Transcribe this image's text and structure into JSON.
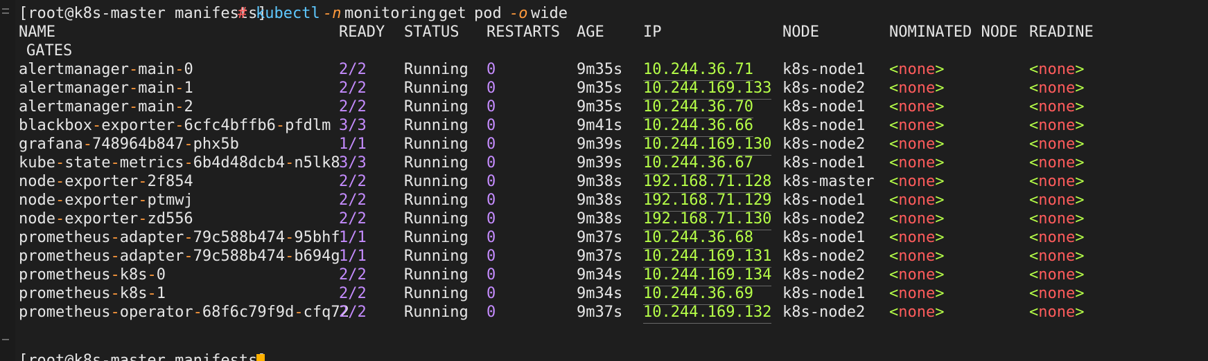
{
  "prompt": {
    "user_host_dir": "[root@k8s-master manifests]",
    "symbol": "#",
    "command": "kubectl",
    "flag_namespace": "-n",
    "namespace": "monitoring",
    "verb": "get",
    "resource": "pod",
    "flag_output": "-o",
    "output": "wide"
  },
  "headers": {
    "name": "NAME",
    "ready": "READY",
    "status": "STATUS",
    "restarts": "RESTARTS",
    "age": "AGE",
    "ip": "IP",
    "node": "NODE",
    "nominated_node": "NOMINATED NODE",
    "readiness_gates_part1": "READINE",
    "readiness_gates_part2": "GATES"
  },
  "pods": [
    {
      "name_parts": [
        "alertmanager",
        "main",
        "0"
      ],
      "ready_cur": "2",
      "ready_total": "2",
      "status": "Running",
      "restarts": "0",
      "age": "9m35s",
      "ip": "10.244.36.71",
      "node": "k8s-node1"
    },
    {
      "name_parts": [
        "alertmanager",
        "main",
        "1"
      ],
      "ready_cur": "2",
      "ready_total": "2",
      "status": "Running",
      "restarts": "0",
      "age": "9m35s",
      "ip": "10.244.169.133",
      "node": "k8s-node2"
    },
    {
      "name_parts": [
        "alertmanager",
        "main",
        "2"
      ],
      "ready_cur": "2",
      "ready_total": "2",
      "status": "Running",
      "restarts": "0",
      "age": "9m35s",
      "ip": "10.244.36.70",
      "node": "k8s-node1"
    },
    {
      "name_parts": [
        "blackbox",
        "exporter",
        "6cfc4bffb6",
        "pfdlm"
      ],
      "ready_cur": "3",
      "ready_total": "3",
      "status": "Running",
      "restarts": "0",
      "age": "9m41s",
      "ip": "10.244.36.66",
      "node": "k8s-node1"
    },
    {
      "name_parts": [
        "grafana",
        "748964b847",
        "phx5b"
      ],
      "ready_cur": "1",
      "ready_total": "1",
      "status": "Running",
      "restarts": "0",
      "age": "9m39s",
      "ip": "10.244.169.130",
      "node": "k8s-node2"
    },
    {
      "name_parts": [
        "kube",
        "state",
        "metrics",
        "6b4d48dcb4",
        "n5lk8"
      ],
      "ready_cur": "3",
      "ready_total": "3",
      "status": "Running",
      "restarts": "0",
      "age": "9m39s",
      "ip": "10.244.36.67",
      "node": "k8s-node1"
    },
    {
      "name_parts": [
        "node",
        "exporter",
        "2f854"
      ],
      "ready_cur": "2",
      "ready_total": "2",
      "status": "Running",
      "restarts": "0",
      "age": "9m38s",
      "ip": "192.168.71.128",
      "node": "k8s-master"
    },
    {
      "name_parts": [
        "node",
        "exporter",
        "ptmwj"
      ],
      "ready_cur": "2",
      "ready_total": "2",
      "status": "Running",
      "restarts": "0",
      "age": "9m38s",
      "ip": "192.168.71.129",
      "node": "k8s-node1"
    },
    {
      "name_parts": [
        "node",
        "exporter",
        "zd556"
      ],
      "ready_cur": "2",
      "ready_total": "2",
      "status": "Running",
      "restarts": "0",
      "age": "9m38s",
      "ip": "192.168.71.130",
      "node": "k8s-node2"
    },
    {
      "name_parts": [
        "prometheus",
        "adapter",
        "79c588b474",
        "95bhf"
      ],
      "ready_cur": "1",
      "ready_total": "1",
      "status": "Running",
      "restarts": "0",
      "age": "9m37s",
      "ip": "10.244.36.68",
      "node": "k8s-node1"
    },
    {
      "name_parts": [
        "prometheus",
        "adapter",
        "79c588b474",
        "b694g"
      ],
      "ready_cur": "1",
      "ready_total": "1",
      "status": "Running",
      "restarts": "0",
      "age": "9m37s",
      "ip": "10.244.169.131",
      "node": "k8s-node2"
    },
    {
      "name_parts": [
        "prometheus",
        "k8s",
        "0"
      ],
      "ready_cur": "2",
      "ready_total": "2",
      "status": "Running",
      "restarts": "0",
      "age": "9m34s",
      "ip": "10.244.169.134",
      "node": "k8s-node2"
    },
    {
      "name_parts": [
        "prometheus",
        "k8s",
        "1"
      ],
      "ready_cur": "2",
      "ready_total": "2",
      "status": "Running",
      "restarts": "0",
      "age": "9m34s",
      "ip": "10.244.36.69",
      "node": "k8s-node1"
    },
    {
      "name_parts": [
        "prometheus",
        "operator",
        "68f6c79f9d",
        "cfq72"
      ],
      "ready_cur": "2",
      "ready_total": "2",
      "status": "Running",
      "restarts": "0",
      "age": "9m37s",
      "ip": "10.244.169.132",
      "node": "k8s-node2"
    }
  ],
  "none_value": "none",
  "next_prompt_partial": "[root@k8s-master manifests]",
  "colors": {
    "background": "#1e1e1e",
    "command": "#5ec8ff",
    "flag": "#ff9a3c",
    "ready": "#c58cff",
    "ip": "#b6ff48",
    "none": "#ff5c5c",
    "cursor": "#ffb100"
  }
}
